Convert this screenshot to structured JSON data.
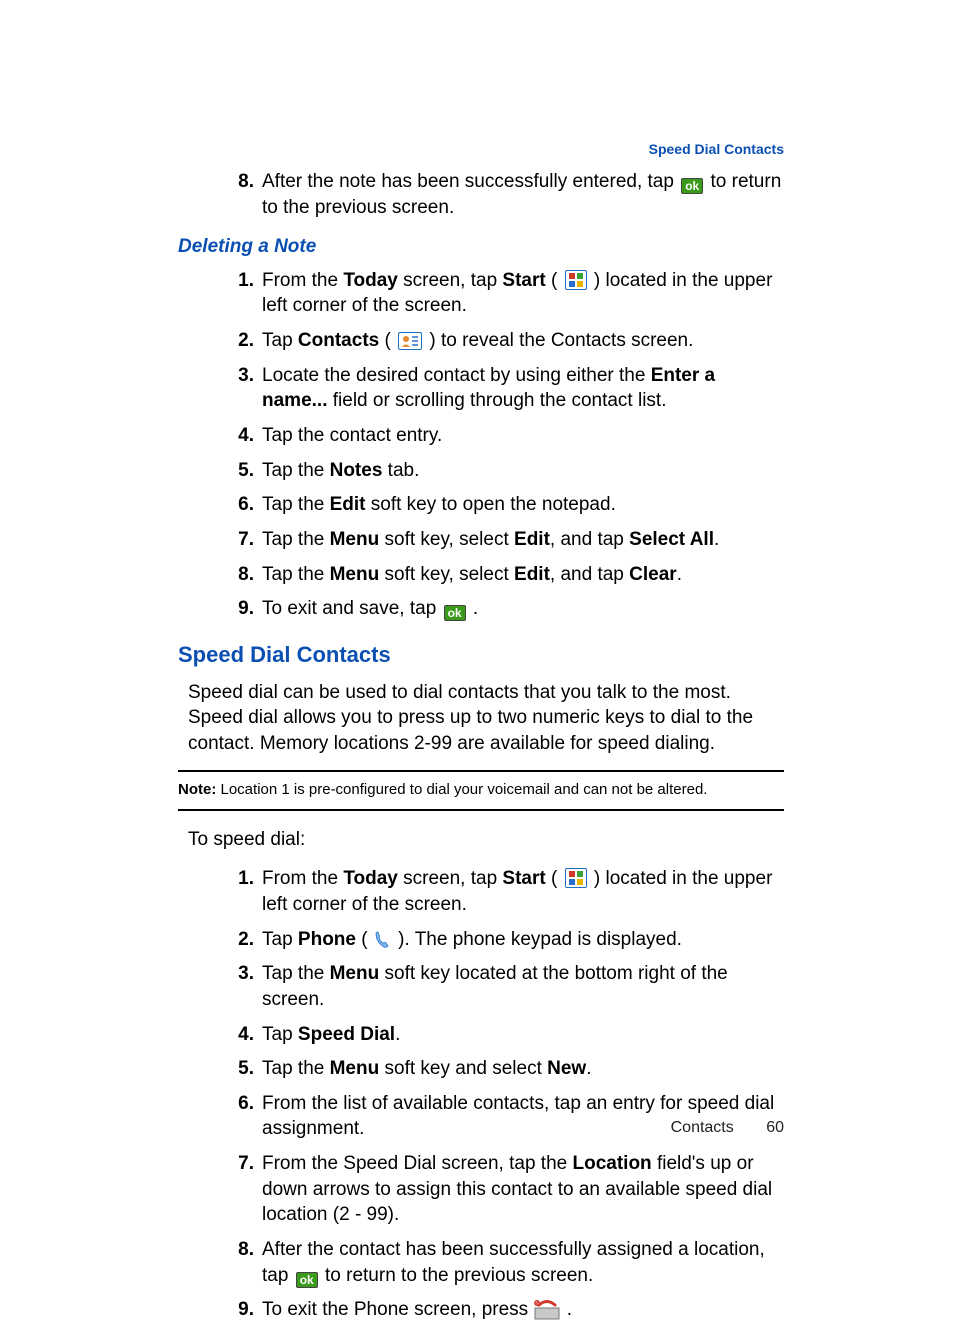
{
  "running_head": "Speed Dial Contacts",
  "intro_step": {
    "num": "8",
    "pre": "After the note has been successfully entered, tap ",
    "post": " to return to the previous screen."
  },
  "deleting": {
    "heading": "Deleting a Note",
    "steps": [
      {
        "num": "1",
        "pre": "From the ",
        "b1": "Today",
        "mid1": " screen, tap ",
        "b2": "Start",
        "mid2": " ( ",
        "post": " ) located in the upper left corner of the screen.",
        "icon": "start"
      },
      {
        "num": "2",
        "pre": "Tap ",
        "b1": "Contacts",
        "mid1": " ( ",
        "post": " ) to reveal the Contacts screen.",
        "icon": "contacts"
      },
      {
        "num": "3",
        "pre": "Locate the desired contact by using either the ",
        "b1": "Enter a name...",
        "post": " field or scrolling through the contact list."
      },
      {
        "num": "4",
        "pre": "Tap the contact entry."
      },
      {
        "num": "5",
        "pre": "Tap the ",
        "b1": "Notes",
        "post": " tab."
      },
      {
        "num": "6",
        "pre": "Tap the ",
        "b1": "Edit",
        "post": " soft key to open the notepad."
      },
      {
        "num": "7",
        "pre": "Tap the ",
        "b1": "Menu",
        "mid1": " soft key, select ",
        "b2": "Edit",
        "mid2": ", and tap ",
        "b3": "Select All",
        "post": "."
      },
      {
        "num": "8",
        "pre": "Tap the ",
        "b1": "Menu",
        "mid1": " soft key, select ",
        "b2": "Edit",
        "mid2": ", and tap ",
        "b3": "Clear",
        "post": "."
      },
      {
        "num": "9",
        "pre": "To exit and save, tap ",
        "post": " .",
        "icon": "ok"
      }
    ]
  },
  "speed": {
    "heading": "Speed Dial Contacts",
    "para": "Speed dial can be used to dial contacts that you talk to the most. Speed dial allows you to press up to two numeric keys to dial to the contact. Memory locations 2-99 are available for speed dialing.",
    "note_label": "Note:",
    "note_text": " Location 1 is pre-configured to dial your voicemail and can not be altered.",
    "lead": "To speed dial:",
    "steps": [
      {
        "num": "1",
        "pre": "From the ",
        "b1": "Today",
        "mid1": " screen, tap ",
        "b2": "Start",
        "mid2": " ( ",
        "post": " ) located in the upper left corner of the screen.",
        "icon": "start"
      },
      {
        "num": "2",
        "pre": "Tap ",
        "b1": "Phone",
        "mid1": " ( ",
        "post": " ). The phone keypad is displayed.",
        "icon": "phone"
      },
      {
        "num": "3",
        "pre": "Tap the ",
        "b1": "Menu",
        "post": " soft key located at the bottom right of the screen."
      },
      {
        "num": "4",
        "pre": "Tap ",
        "b1": "Speed Dial",
        "post": "."
      },
      {
        "num": "5",
        "pre": "Tap the ",
        "b1": "Menu",
        "mid1": " soft key and select ",
        "b2": "New",
        "post": "."
      },
      {
        "num": "6",
        "pre": "From the list of available contacts, tap an entry for speed dial assignment."
      },
      {
        "num": "7",
        "pre": "From the Speed Dial screen, tap the ",
        "b1": "Location",
        "post": " field's up or down arrows to assign this contact to an available speed dial location (2 - 99)."
      },
      {
        "num": "8",
        "pre": "After the contact has been successfully assigned a location, tap ",
        "post": " to return to the previous screen.",
        "icon": "ok"
      },
      {
        "num": "9",
        "pre": "To exit the Phone screen, press ",
        "post": " .",
        "icon": "end"
      }
    ]
  },
  "footer": {
    "section": "Contacts",
    "page": "60"
  },
  "icons": {
    "ok_label": "ok"
  }
}
